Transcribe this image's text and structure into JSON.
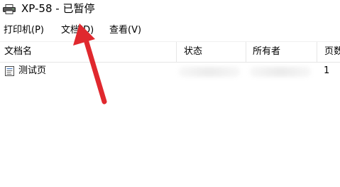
{
  "window": {
    "title": "XP-58 - 已暂停",
    "icon": "printer-icon"
  },
  "menu": {
    "items": [
      {
        "label": "打印机(P)"
      },
      {
        "label": "文档(D)"
      },
      {
        "label": "查看(V)"
      }
    ]
  },
  "table": {
    "columns": [
      "文档名",
      "状态",
      "所有者",
      "页数"
    ],
    "rows": [
      {
        "name": "测试页",
        "status": "",
        "owner": "",
        "pages": "1",
        "icon": "document-icon"
      }
    ]
  },
  "annotation": {
    "arrow_color": "#e0282e",
    "points_to": "文档(D) menu"
  },
  "colors": {
    "background": "#ffffff",
    "text": "#000000",
    "divider": "#e6e6e6",
    "arrow": "#e0282e"
  }
}
